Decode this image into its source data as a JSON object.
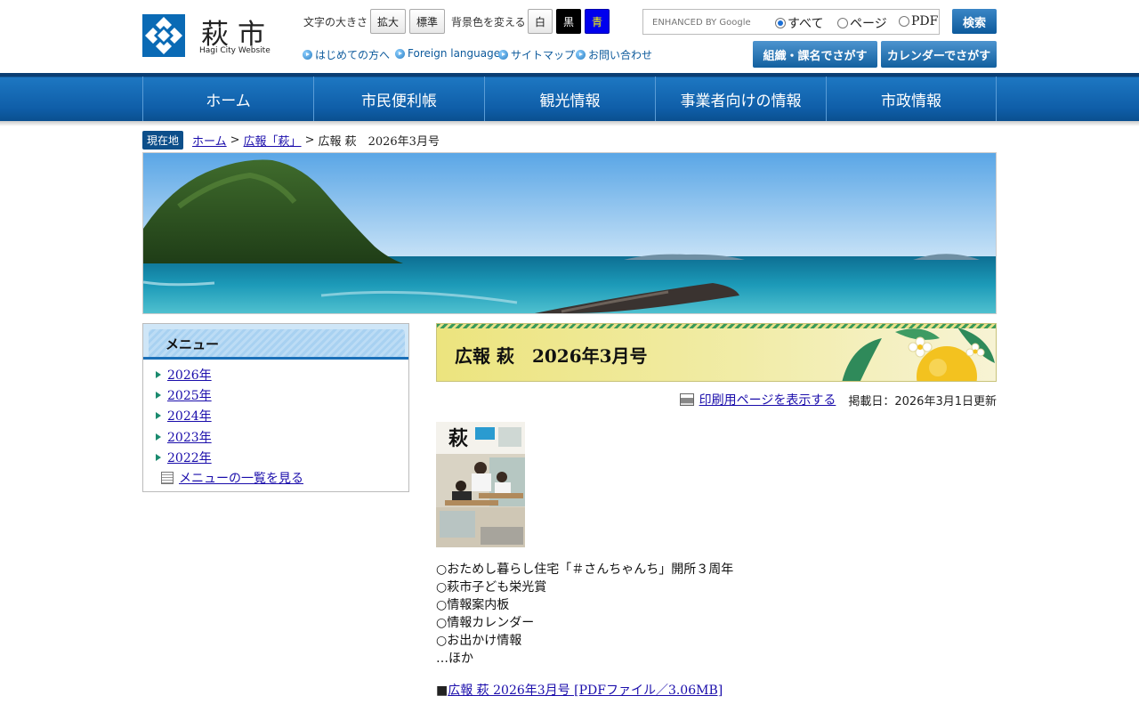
{
  "header": {
    "logo_text": "萩市",
    "logo_sub": "Hagi City Website",
    "font_size_label": "文字の大きさ",
    "font_enlarge": "拡大",
    "font_standard": "標準",
    "bg_color_label": "背景色を変える",
    "bg_white": "白",
    "bg_black": "黒",
    "bg_blue": "青",
    "search_placeholder": "ENHANCED BY Google",
    "scope_all": "すべて",
    "scope_page": "ページ",
    "scope_pdf": "PDF",
    "search_button": "検索",
    "util_links": [
      "はじめての方へ",
      "Foreign language",
      "サイトマップ",
      "お問い合わせ"
    ],
    "org_search": "組織・課名でさがす",
    "calendar_search": "カレンダーでさがす"
  },
  "nav": {
    "items": [
      "ホーム",
      "市民便利帳",
      "観光情報",
      "事業者向けの情報",
      "市政情報"
    ]
  },
  "breadcrumb": {
    "label": "現在地",
    "home": "ホーム",
    "sep1": ">",
    "parent": "広報「萩」",
    "sep2": ">",
    "current": "広報 萩　2026年3月号"
  },
  "sidebar": {
    "title": "メニュー",
    "items": [
      "2026年",
      "2025年",
      "2024年",
      "2023年",
      "2022年"
    ],
    "all_link": "メニューの一覧を見る"
  },
  "main": {
    "title": "広報 萩　2026年3月号",
    "print_link": "印刷用ページを表示する",
    "posted": "掲載日：2026年3月1日更新",
    "contents": [
      "○おためし暮らし住宅「＃さんちゃんち」開所３周年",
      "○萩市子ども栄光賞",
      "○情報案内板",
      "○情報カレンダー",
      "○お出かけ情報",
      "…ほか"
    ],
    "pdf_prefix": "■",
    "pdf_link": "広報 萩 2026年3月号 [PDFファイル／3.06MB]"
  },
  "cover": {
    "logo": "萩"
  },
  "colors": {
    "brand_blue": "#0f5ea8",
    "title_band": "#ece47e",
    "link": "#1a0dab"
  }
}
